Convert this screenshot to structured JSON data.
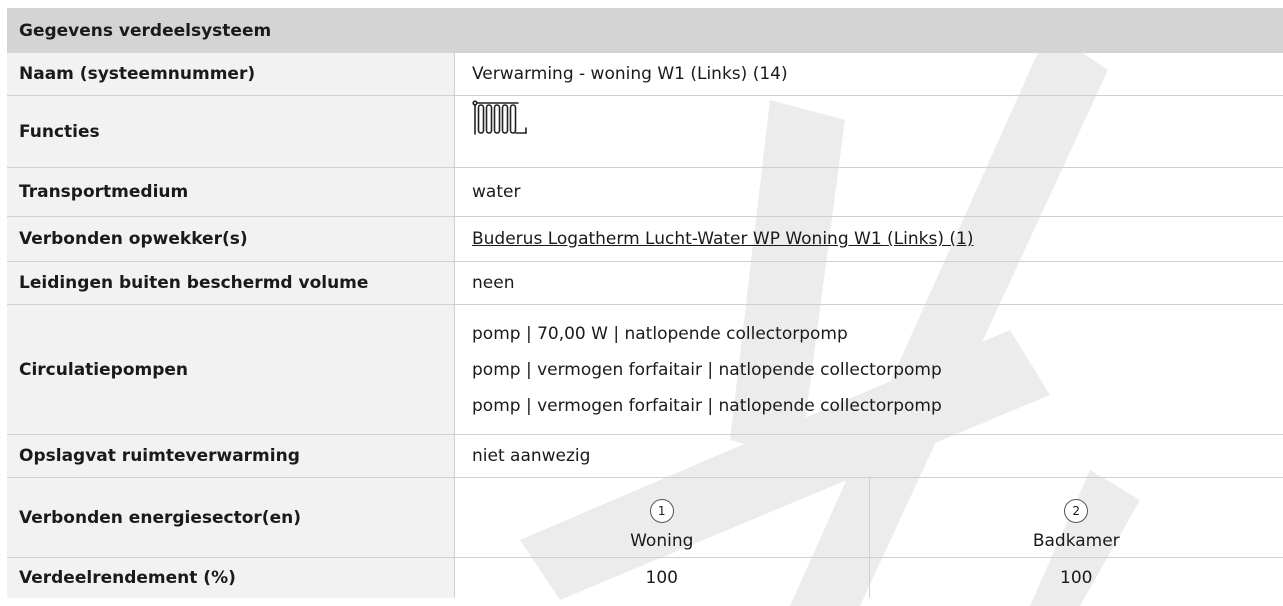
{
  "header": {
    "title": "Gegevens verdeelsysteem"
  },
  "rows": {
    "naam": {
      "label": "Naam (systeemnummer)",
      "value": "Verwarming - woning W1 (Links) (14)"
    },
    "functies": {
      "label": "Functies",
      "icon": "radiator-icon"
    },
    "transport": {
      "label": "Transportmedium",
      "value": "water"
    },
    "opwekker": {
      "label": "Verbonden opwekker(s)",
      "value": "Buderus Logatherm Lucht-Water WP Woning W1 (Links) (1)"
    },
    "leidingen": {
      "label": "Leidingen buiten beschermd volume",
      "value": "neen"
    },
    "pompen": {
      "label": "Circulatiepompen",
      "items": [
        "pomp | 70,00 W | natlopende collectorpomp",
        "pomp | vermogen forfaitair | natlopende collectorpomp",
        "pomp | vermogen forfaitair | natlopende collectorpomp"
      ]
    },
    "opslagvat": {
      "label": "Opslagvat ruimteverwarming",
      "value": "niet aanwezig"
    },
    "sectoren": {
      "label": "Verbonden energiesector(en)",
      "items": [
        {
          "number": "1",
          "name": "Woning"
        },
        {
          "number": "2",
          "name": "Badkamer"
        }
      ]
    },
    "rendement": {
      "label": "Verdeelrendement (%)",
      "values": [
        "100",
        "100"
      ]
    }
  },
  "colors": {
    "header_bg": "#d4d4d4",
    "label_bg": "#f2f2f2",
    "border": "#d0d0d0",
    "watermark": "#ececec"
  }
}
